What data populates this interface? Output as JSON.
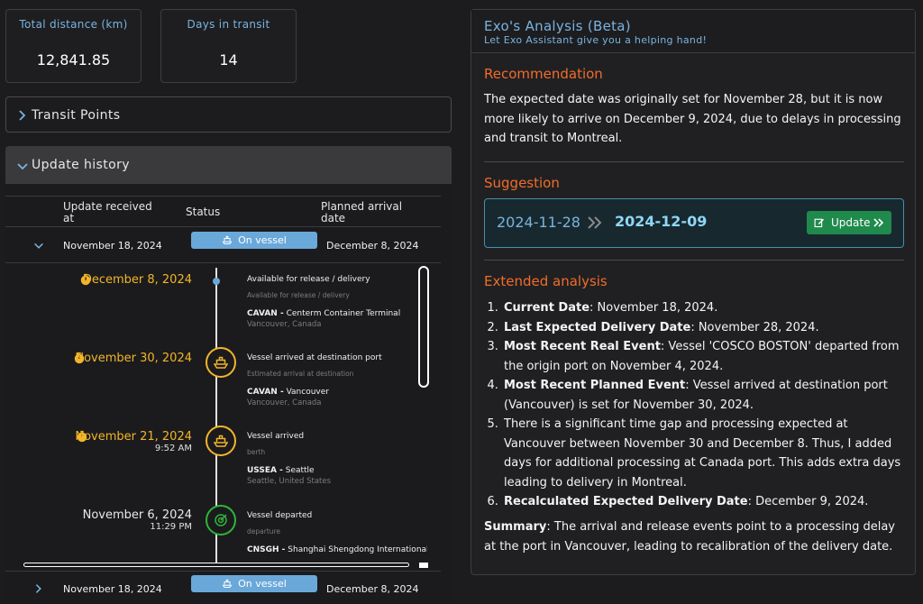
{
  "stats": [
    {
      "label": "Total distance (km)",
      "value": "12,841.85"
    },
    {
      "label": "Days in transit",
      "value": "14"
    }
  ],
  "transit_points": {
    "title": "Transit Points"
  },
  "update_history": {
    "title": "Update history",
    "columns": {
      "received": "Update received at",
      "status": "Status",
      "planned": "Planned arrival date"
    },
    "rows": [
      {
        "received": "November 18, 2024",
        "status": "On vessel",
        "planned": "December 8, 2024"
      },
      {
        "received": "November 18, 2024",
        "status": "On vessel",
        "planned": "December 8, 2024"
      }
    ],
    "timeline": [
      {
        "date": "December 8, 2024",
        "time": "",
        "title": "Available for release / delivery",
        "subtitle": "Available for release / delivery",
        "code": "CAVAN -",
        "location": "Centerm Container Terminal",
        "place": "Vancouver, Canada",
        "icon": "dot-icon"
      },
      {
        "date": "November 30, 2024",
        "time": "",
        "title": "Vessel arrived at destination port",
        "subtitle": "Estimated arrival at destination",
        "code": "CAVAN -",
        "location": "Vancouver",
        "place": "Vancouver, Canada",
        "icon": "ship-icon"
      },
      {
        "date": "November 21, 2024",
        "time": "9:52 AM",
        "title": "Vessel arrived",
        "subtitle": "berth",
        "code": "USSEA -",
        "location": "Seattle",
        "place": "Seattle, United States",
        "icon": "ship-icon"
      },
      {
        "date": "November 6, 2024",
        "time": "11:29 PM",
        "title": "Vessel departed",
        "subtitle": "departure",
        "code": "CNSGH -",
        "location": "Shanghai Shengdong International Container Terminal",
        "place": "",
        "icon": "target-icon"
      }
    ]
  },
  "analysis": {
    "title": "Exo's Analysis (Beta)",
    "subtitle": "Let Exo Assistant give you a helping hand!",
    "recommendation_heading": "Recommendation",
    "recommendation_text": "The expected date was originally set for November 28, but it is now more likely to arrive on December 9, 2024, due to delays in processing and transit to Montreal.",
    "suggestion_heading": "Suggestion",
    "suggestion_old": "2024-11-28",
    "suggestion_new": "2024-12-09",
    "update_label": "Update",
    "extended_heading": "Extended analysis",
    "items": [
      {
        "bold": "Current Date",
        "text": ": November 18, 2024."
      },
      {
        "bold": "Last Expected Delivery Date",
        "text": ": November 28, 2024."
      },
      {
        "bold": "Most Recent Real Event",
        "text": ": Vessel 'COSCO BOSTON' departed from the origin port on November 4, 2024."
      },
      {
        "bold": "Most Recent Planned Event",
        "text": ": Vessel arrived at destination port (Vancouver) is set for November 30, 2024."
      },
      {
        "bold": "",
        "text": "There is a significant time gap and processing expected at Vancouver between November 30 and December 8. Thus, I added days for additional processing at Canada port. This adds extra days leading to delivery in Montreal."
      },
      {
        "bold": "Recalculated Expected Delivery Date",
        "text": ": December 9, 2024."
      }
    ],
    "summary_bold": "Summary",
    "summary_text": ": The arrival and release events point to a processing delay at the port in Vancouver, leading to recalibration of the delivery date."
  },
  "colors": {
    "accent_blue": "#79b3e0",
    "accent_orange": "#f16c2a",
    "accent_yellow": "#f2b52a",
    "accent_green": "#2db53a",
    "update_green": "#1f8a4c"
  }
}
